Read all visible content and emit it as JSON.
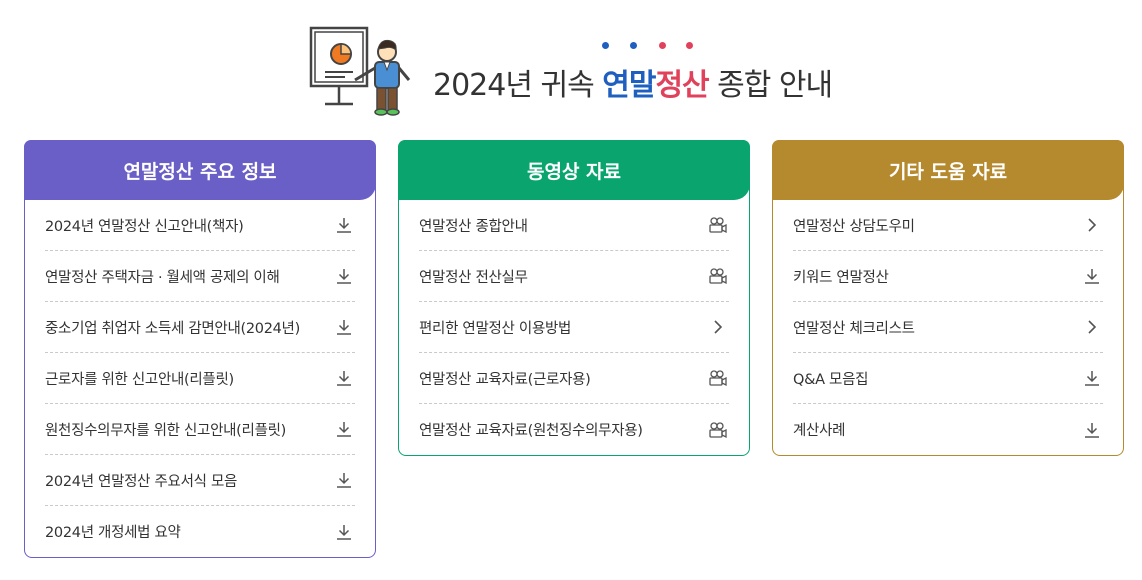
{
  "header": {
    "title_prefix": "2024년 귀속 ",
    "title_blue": "연말",
    "title_pink": "정산",
    "title_suffix": " 종합 안내",
    "dot_colors": [
      "#1f5fbf",
      "#1f5fbf",
      "#e0425b",
      "#e0425b"
    ]
  },
  "cards": [
    {
      "title": "연말정산 주요 정보",
      "color": "#6a5ec7",
      "items": [
        {
          "label": "2024년 연말정산 신고안내(책자)",
          "icon": "download-icon"
        },
        {
          "label": "연말정산 주택자금 · 월세액 공제의 이해",
          "icon": "download-icon"
        },
        {
          "label": "중소기업 취업자 소득세 감면안내(2024년)",
          "icon": "download-icon"
        },
        {
          "label": "근로자를 위한 신고안내(리플릿)",
          "icon": "download-icon"
        },
        {
          "label": "원천징수의무자를 위한 신고안내(리플릿)",
          "icon": "download-icon"
        },
        {
          "label": "2024년 연말정산 주요서식 모음",
          "icon": "download-icon"
        },
        {
          "label": "2024년 개정세법 요약",
          "icon": "download-icon"
        }
      ]
    },
    {
      "title": "동영상 자료",
      "color": "#0aa56f",
      "items": [
        {
          "label": "연말정산 종합안내",
          "icon": "video-camera-icon"
        },
        {
          "label": "연말정산 전산실무",
          "icon": "video-camera-icon"
        },
        {
          "label": "편리한 연말정산 이용방법",
          "icon": "chevron-right-icon"
        },
        {
          "label": "연말정산 교육자료(근로자용)",
          "icon": "video-camera-icon"
        },
        {
          "label": "연말정산 교육자료(원천징수의무자용)",
          "icon": "video-camera-icon"
        }
      ]
    },
    {
      "title": "기타 도움 자료",
      "color": "#b5892d",
      "items": [
        {
          "label": "연말정산 상담도우미",
          "icon": "chevron-right-icon"
        },
        {
          "label": "키워드 연말정산",
          "icon": "download-icon"
        },
        {
          "label": "연말정산 체크리스트",
          "icon": "chevron-right-icon"
        },
        {
          "label": "Q&A 모음집",
          "icon": "download-icon"
        },
        {
          "label": "계산사례",
          "icon": "download-icon"
        }
      ]
    }
  ]
}
